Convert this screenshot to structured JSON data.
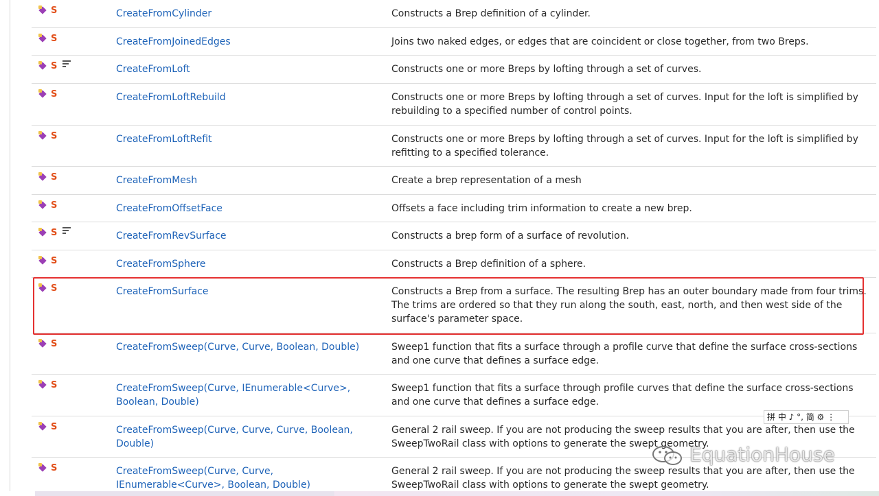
{
  "rows": [
    {
      "name": "CreateFromCylinder",
      "description": "Constructs a Brep definition of a cylinder.",
      "overload": false
    },
    {
      "name": "CreateFromJoinedEdges",
      "description": "Joins two naked edges, or edges that are coincident or close together, from two Breps.",
      "overload": false
    },
    {
      "name": "CreateFromLoft",
      "description": "Constructs one or more Breps by lofting through a set of curves.",
      "overload": true
    },
    {
      "name": "CreateFromLoftRebuild",
      "description": "Constructs one or more Breps by lofting through a set of curves. Input for the loft is simplified by rebuilding to a specified number of control points.",
      "overload": false
    },
    {
      "name": "CreateFromLoftRefit",
      "description": "Constructs one or more Breps by lofting through a set of curves. Input for the loft is simplified by refitting to a specified tolerance.",
      "overload": false
    },
    {
      "name": "CreateFromMesh",
      "description": "Create a brep representation of a mesh",
      "overload": false
    },
    {
      "name": "CreateFromOffsetFace",
      "description": "Offsets a face including trim information to create a new brep.",
      "overload": false
    },
    {
      "name": "CreateFromRevSurface",
      "description": "Constructs a brep form of a surface of revolution.",
      "overload": true
    },
    {
      "name": "CreateFromSphere",
      "description": "Constructs a Brep definition of a sphere.",
      "overload": false
    },
    {
      "name": "CreateFromSurface",
      "description": "Constructs a Brep from a surface. The resulting Brep has an outer boundary made from four trims. The trims are ordered so that they run along the south, east, north, and then west side of the surface's parameter space.",
      "overload": false
    },
    {
      "name": "CreateFromSweep(Curve, Curve, Boolean, Double)",
      "description": "Sweep1 function that fits a surface through a profile curve that define the surface cross-sections and one curve that defines a surface edge.",
      "overload": false
    },
    {
      "name": "CreateFromSweep(Curve, IEnumerable<Curve>, Boolean, Double)",
      "description": "Sweep1 function that fits a surface through profile curves that define the surface cross-sections and one curve that defines a surface edge.",
      "overload": false
    },
    {
      "name": "CreateFromSweep(Curve, Curve, Curve, Boolean, Double)",
      "description": "General 2 rail sweep. If you are not producing the sweep results that you are after, then use the SweepTwoRail class with options to generate the swept geometry.",
      "overload": false
    },
    {
      "name": "CreateFromSweep(Curve, Curve, IEnumerable<Curve>, Boolean, Double)",
      "description": "General 2 rail sweep. If you are not producing the sweep results that you are after, then use the SweepTwoRail class with options to generate the swept geometry.",
      "overload": false
    }
  ],
  "icons": {
    "method": "public-method-icon",
    "static": "S",
    "overload": "overload-icon"
  },
  "ime_toolbar": "拼 中 ♪ °, 简 ⚙ ⋮",
  "watermark": "EquationHouse",
  "colors": {
    "link": "#1e63b8",
    "static": "#e2501b",
    "highlight": "#e53030"
  }
}
